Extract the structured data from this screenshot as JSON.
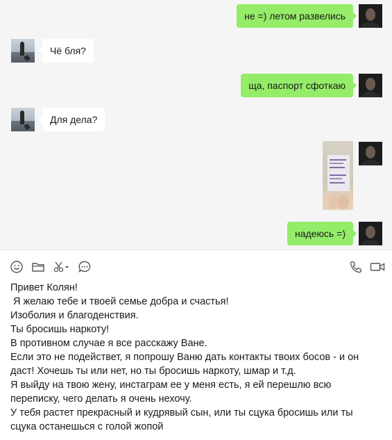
{
  "messages": [
    {
      "side": "out",
      "text": "не =) летом развелись"
    },
    {
      "side": "in",
      "text": "Чё бля?"
    },
    {
      "side": "out",
      "text": "ща, паспорт сфоткаю"
    },
    {
      "side": "in",
      "text": "Для дела?"
    },
    {
      "side": "out",
      "type": "image",
      "icon": "passport-photo"
    },
    {
      "side": "out",
      "text": "надеюсь =)"
    }
  ],
  "toolbar": {
    "left": [
      "emoji-icon",
      "folder-icon",
      "scissors-icon",
      "chat-history-icon"
    ],
    "right": [
      "phone-icon",
      "video-call-icon"
    ]
  },
  "draft_lines": [
    "Привет Колян!",
    " Я желаю тебе и твоей семье добра и счастья!",
    "Изоболия и благоденствия.",
    "Ты бросишь наркоту!",
    "В противном случае я все расскажу Ване.",
    "Если это не подействет, я попрошу Ваню дать контакты твоих босов - и он",
    "даст! Хочешь ты или нет, но ты бросишь наркоту, шмар и т.д.",
    "Я выйду на твою жену, инстаграм ее у меня есть, я ей перешлю всю",
    "переписку, чего делать я очень нехочу.",
    "У тебя растет прекрасный и кудрявый сын, или ты сцука бросишь или ты",
    "сцука останешься с голой жопой"
  ],
  "colors": {
    "outgoing_bubble": "#95ec69",
    "incoming_bubble": "#ffffff",
    "chat_background": "#f5f5f5"
  }
}
